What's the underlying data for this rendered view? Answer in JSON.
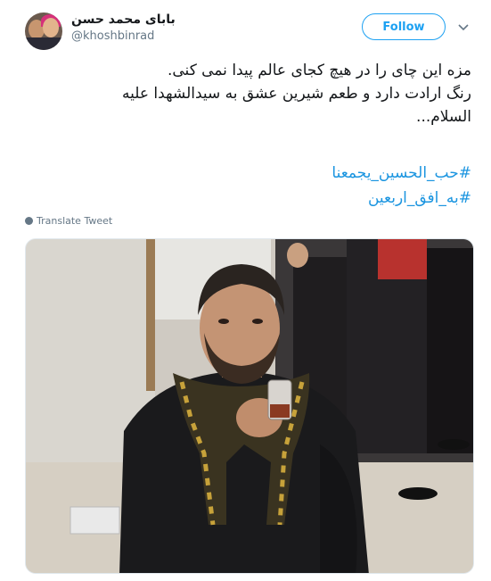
{
  "header": {
    "display_name": "بابای محمد حسن",
    "handle": "@khoshbinrad",
    "follow_label": "Follow"
  },
  "tweet": {
    "lines": [
      "مزه این چای را در هیچ کجای عالم پیدا نمی کنی.",
      "رنگ ارادت دارد و طعم شیرین عشق به سیدالشهدا علیه",
      "السلام..."
    ],
    "hashtags": [
      "#حب_الحسین_یجمعنا",
      "#به_افق_اربعین"
    ],
    "translate_label": "Translate Tweet"
  },
  "colors": {
    "accent": "#1da1f2",
    "link": "#1b95e0",
    "muted": "#657786"
  }
}
